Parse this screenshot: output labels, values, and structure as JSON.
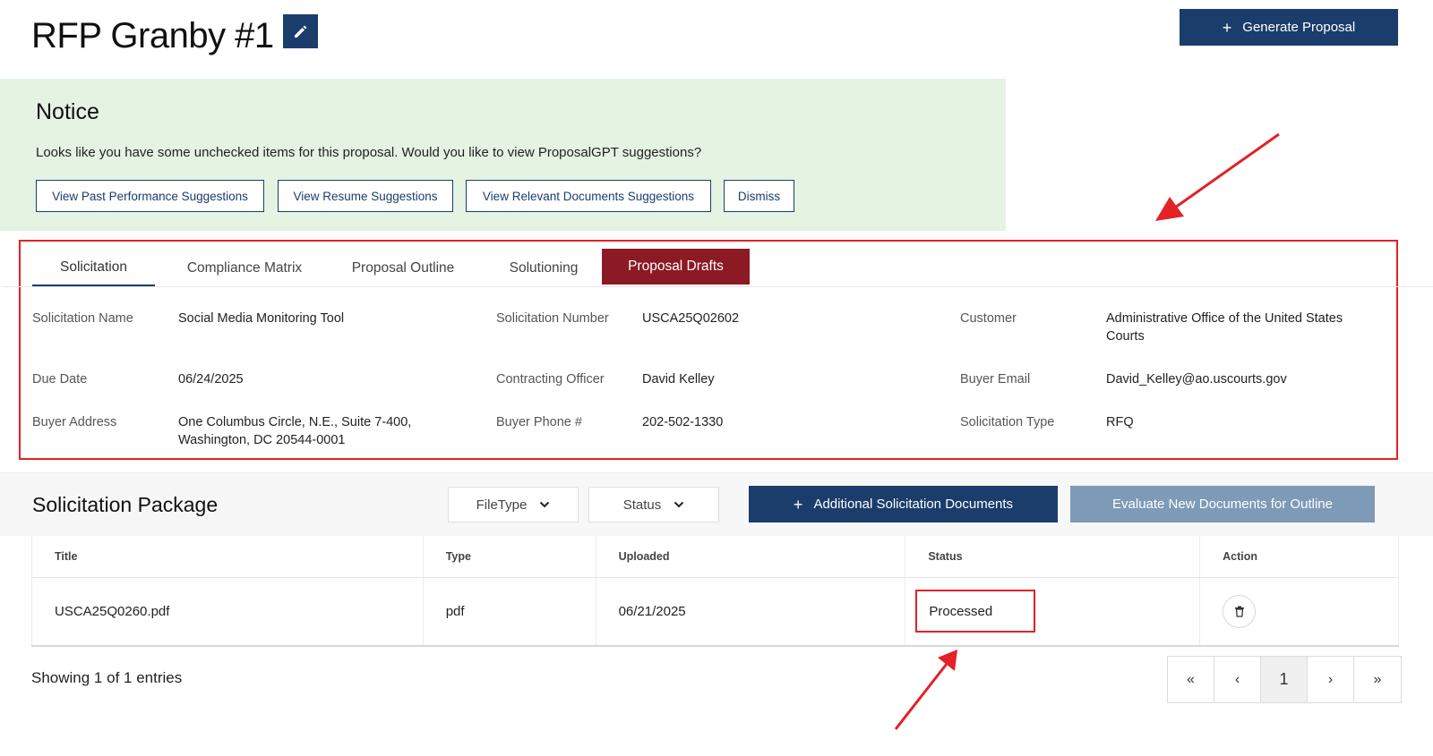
{
  "header": {
    "title": "RFP Granby #1",
    "edit_icon": "pencil-icon",
    "generate_label": "Generate Proposal",
    "generate_icon": "plus-icon"
  },
  "notice": {
    "title": "Notice",
    "text": "Looks like you have some unchecked items for this proposal. Would you like to view ProposalGPT suggestions?",
    "buttons": [
      {
        "label": "View Past Performance Suggestions"
      },
      {
        "label": "View Resume Suggestions"
      },
      {
        "label": "View Relevant Documents Suggestions"
      },
      {
        "label": "Dismiss"
      }
    ]
  },
  "tabs": [
    {
      "label": "Solicitation"
    },
    {
      "label": "Compliance Matrix"
    },
    {
      "label": "Proposal Outline"
    },
    {
      "label": "Solutioning"
    },
    {
      "label": "Proposal Drafts"
    }
  ],
  "details": {
    "solicitation_name": {
      "label": "Solicitation Name",
      "value": "Social Media Monitoring Tool"
    },
    "solicitation_number": {
      "label": "Solicitation Number",
      "value": "USCA25Q02602"
    },
    "customer": {
      "label": "Customer",
      "value": "Administrative Office of the United States Courts"
    },
    "due_date": {
      "label": "Due Date",
      "value": "06/24/2025"
    },
    "contracting_officer": {
      "label": "Contracting Officer",
      "value": "David Kelley"
    },
    "buyer_email": {
      "label": "Buyer Email",
      "value": "David_Kelley@ao.uscourts.gov"
    },
    "buyer_address": {
      "label": "Buyer Address",
      "value_line1": "One Columbus Circle, N.E., Suite 7-400,",
      "value_line2": "Washington, DC 20544-0001"
    },
    "buyer_phone": {
      "label": "Buyer Phone #",
      "value": "202-502-1330"
    },
    "solicitation_type": {
      "label": "Solicitation Type",
      "value": "RFQ"
    }
  },
  "package": {
    "title": "Solicitation Package",
    "filetype_filter": "FileType",
    "status_filter": "Status",
    "add_docs_label": "Additional Solicitation Documents",
    "evaluate_label": "Evaluate New Documents for Outline"
  },
  "table": {
    "columns": [
      "Title",
      "Type",
      "Uploaded",
      "Status",
      "Action"
    ],
    "rows": [
      {
        "title": "USCA25Q0260.pdf",
        "type": "pdf",
        "uploaded": "06/21/2025",
        "status": "Processed",
        "action_icon": "trash-icon"
      }
    ]
  },
  "pagination": {
    "entries_text": "Showing 1 of 1 entries",
    "first": "«",
    "prev": "‹",
    "current": "1",
    "next": "›",
    "last": "»"
  },
  "colors": {
    "primary": "#1b3d6b",
    "active_tab": "#8b1a24",
    "notice_bg": "#e4f3e2",
    "annotation_red": "#e32127",
    "disabled_button": "#7d9ab6"
  }
}
